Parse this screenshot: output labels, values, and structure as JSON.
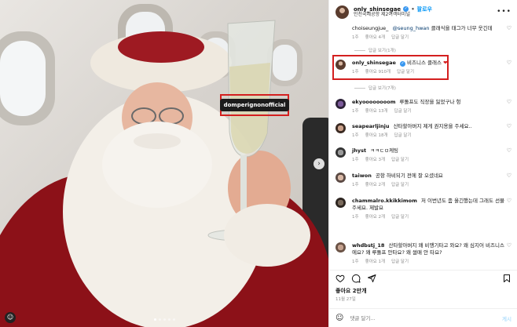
{
  "photo": {
    "tag_label": "domperignonofficial",
    "next_icon": "chevron-right-icon",
    "carousel_count": 5,
    "carousel_active": 0
  },
  "header": {
    "username": "only_shinsegae",
    "follow_label": "팔로우",
    "location": "인천국제공항 제2여객터미널",
    "more_icon": "more-horizontal-icon"
  },
  "comments": [
    {
      "username": "choiseungjue_",
      "mention": "@seung_hwan",
      "text": "클래식을 태그가 너무 웃긴데",
      "time": "1주",
      "likes": "좋아요 4개",
      "reply": "답글 달기",
      "replies": "답글 보기(1개)"
    },
    {
      "username": "only_shinsegae",
      "text": "비즈니스 클래스",
      "emoji": "❤",
      "time": "1주",
      "likes": "좋아요 910개",
      "reply": "답글 달기",
      "replies": "답글 보기(7개)"
    },
    {
      "username": "ekyoooooooom",
      "text": "루돌프도 직장을 잃었구나 헝",
      "time": "1주",
      "likes": "좋아요 13개",
      "reply": "답글 달기"
    },
    {
      "username": "seapearljinju",
      "text": "산타할아버지 제게 권지용을 주세요..",
      "time": "1주",
      "likes": "좋아요 18개",
      "reply": "답글 달기"
    },
    {
      "username": "jhyst",
      "text": "ㅋㅋㄷㅁ케팅",
      "time": "1주",
      "likes": "좋아요 3개",
      "reply": "답글 달기"
    },
    {
      "username": "taiwon",
      "text": "공항 하비되기 전에 잘 오셨네요",
      "time": "1주",
      "likes": "좋아요 2개",
      "reply": "답글 달기"
    },
    {
      "username": "chammalro.kkikkimom",
      "text": "저 이번년도 좀 올긴했는데 그래도 선물주세요. 제발요",
      "time": "1주",
      "likes": "좋아요 2개",
      "reply": "답글 달기"
    },
    {
      "username": "whdbstj_18",
      "text": "산타할아버지 왜 비행기타고 와요? 왜 심지어 비즈니스에요? 왜 루돌프 안타요? 왜 썰매 안 타요?",
      "time": "1주",
      "likes": "좋아요 1개",
      "reply": "답글 달기"
    }
  ],
  "actions": {
    "like_icon": "heart-icon",
    "comment_icon": "comment-icon",
    "share_icon": "send-icon",
    "save_icon": "bookmark-icon"
  },
  "likes_label": "좋아요 2만개",
  "date": "11월 27일",
  "comment_bar": {
    "emoji_icon": "smile-icon",
    "placeholder": "댓글 달기...",
    "post_label": "게시"
  },
  "colors": {
    "accent": "#0095f6",
    "highlight": "#d41f1f",
    "muted": "#8e8e8e"
  }
}
